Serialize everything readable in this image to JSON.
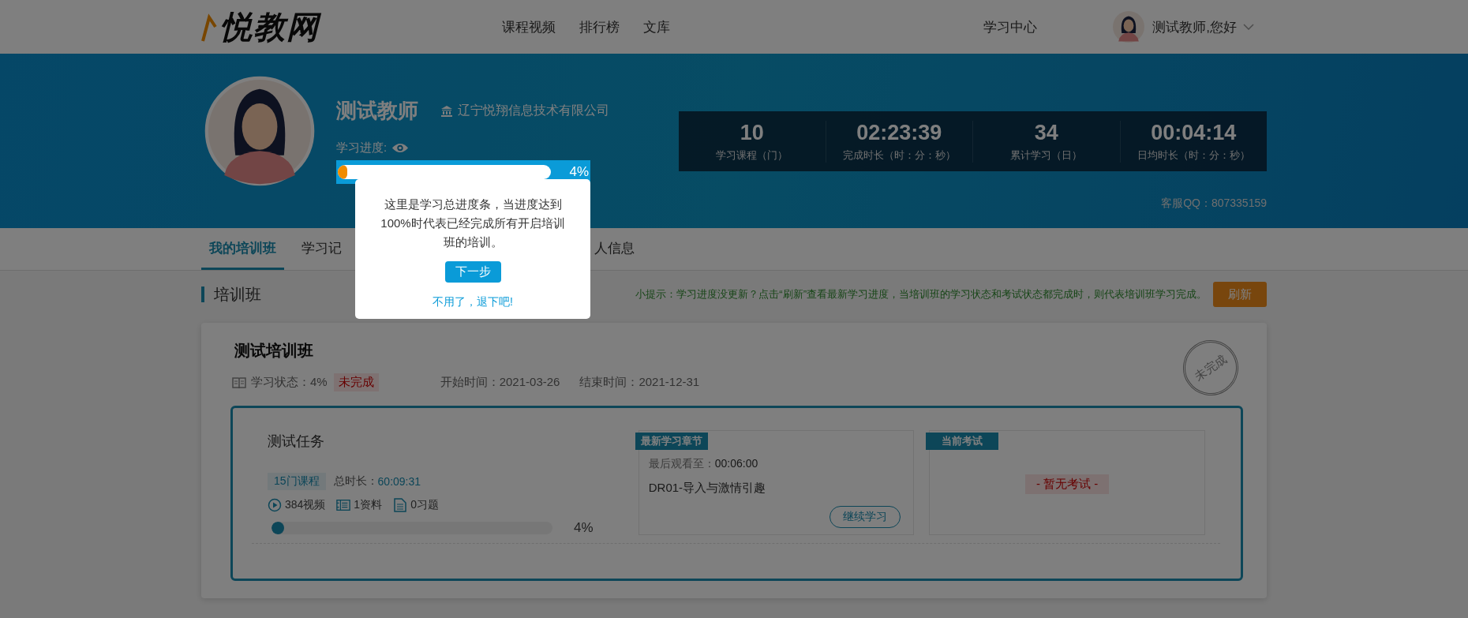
{
  "header": {
    "logo": "悦教网",
    "nav": [
      {
        "label": "课程视频"
      },
      {
        "label": "排行榜"
      },
      {
        "label": "文库"
      }
    ],
    "study_center": "学习中心",
    "greeting": "测试教师,您好"
  },
  "profile": {
    "name": "测试教师",
    "company": "辽宁悦翔信息技术有限公司",
    "progress_label": "学习进度:",
    "progress": {
      "level": 0.04,
      "reading": "4%"
    },
    "stats": [
      {
        "value": "10",
        "label": "学习课程（门）"
      },
      {
        "value": "02:23:39",
        "label": "完成时长（时：分：秒）"
      },
      {
        "value": "34",
        "label": "累计学习（日）"
      },
      {
        "value": "00:04:14",
        "label": "日均时长（时：分：秒）"
      }
    ],
    "qq": "客服QQ：807335159"
  },
  "tabs": [
    {
      "label": "我的培训班",
      "selected": true
    },
    {
      "label": "学习记",
      "selected": false
    },
    {
      "label": "人信息",
      "selected": false
    }
  ],
  "section": {
    "title": "培训班",
    "tip": "小提示：学习进度没更新？点击“刷新”查看最新学习进度，当培训班的学习状态和考试状态都完成时，则代表培训班学习完成。",
    "refresh": "刷新"
  },
  "class_card": {
    "title": "测试培训班",
    "status_label": "学习状态：4%",
    "status_badge": "未完成",
    "start": "开始时间：2021-03-26",
    "end": "结束时间：2021-12-31",
    "stamp": "未完成",
    "task": {
      "name": "测试任务",
      "courses": "15门课程",
      "duration_label": "总时长：",
      "duration": "60:09:31",
      "counts": [
        {
          "kind": "video",
          "text": "384视频"
        },
        {
          "kind": "material",
          "text": "1资料"
        },
        {
          "kind": "exercise",
          "text": "0习题"
        }
      ],
      "progress": {
        "level": 0.04,
        "reading": "4%"
      }
    },
    "chapter": {
      "tag": "最新学习章节",
      "last_watched_label": "最后观看至：",
      "last_watched": "00:06:00",
      "title": "DR01-导入与激情引趣",
      "button": "继续学习"
    },
    "exam": {
      "tag": "当前考试",
      "empty": "- 暂无考试 -"
    }
  },
  "tour": {
    "text": "这里是学习总进度条，当进度达到100%时代表已经完成所有开启培训班的培训。",
    "next": "下一步",
    "dismiss": "不用了，退下吧!"
  }
}
